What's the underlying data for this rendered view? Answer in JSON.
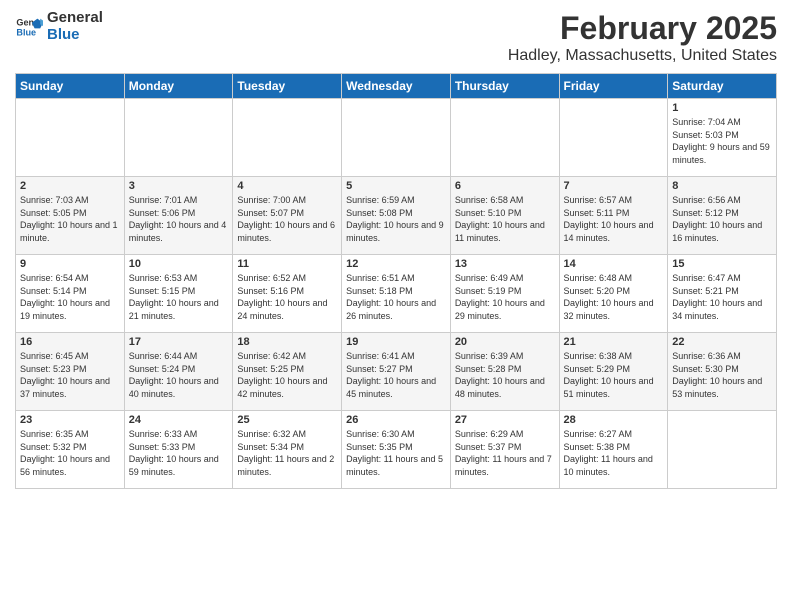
{
  "logo": {
    "line1": "General",
    "line2": "Blue"
  },
  "title": "February 2025",
  "subtitle": "Hadley, Massachusetts, United States",
  "headers": [
    "Sunday",
    "Monday",
    "Tuesday",
    "Wednesday",
    "Thursday",
    "Friday",
    "Saturday"
  ],
  "weeks": [
    [
      {
        "day": "",
        "info": ""
      },
      {
        "day": "",
        "info": ""
      },
      {
        "day": "",
        "info": ""
      },
      {
        "day": "",
        "info": ""
      },
      {
        "day": "",
        "info": ""
      },
      {
        "day": "",
        "info": ""
      },
      {
        "day": "1",
        "info": "Sunrise: 7:04 AM\nSunset: 5:03 PM\nDaylight: 9 hours and 59 minutes."
      }
    ],
    [
      {
        "day": "2",
        "info": "Sunrise: 7:03 AM\nSunset: 5:05 PM\nDaylight: 10 hours and 1 minute."
      },
      {
        "day": "3",
        "info": "Sunrise: 7:01 AM\nSunset: 5:06 PM\nDaylight: 10 hours and 4 minutes."
      },
      {
        "day": "4",
        "info": "Sunrise: 7:00 AM\nSunset: 5:07 PM\nDaylight: 10 hours and 6 minutes."
      },
      {
        "day": "5",
        "info": "Sunrise: 6:59 AM\nSunset: 5:08 PM\nDaylight: 10 hours and 9 minutes."
      },
      {
        "day": "6",
        "info": "Sunrise: 6:58 AM\nSunset: 5:10 PM\nDaylight: 10 hours and 11 minutes."
      },
      {
        "day": "7",
        "info": "Sunrise: 6:57 AM\nSunset: 5:11 PM\nDaylight: 10 hours and 14 minutes."
      },
      {
        "day": "8",
        "info": "Sunrise: 6:56 AM\nSunset: 5:12 PM\nDaylight: 10 hours and 16 minutes."
      }
    ],
    [
      {
        "day": "9",
        "info": "Sunrise: 6:54 AM\nSunset: 5:14 PM\nDaylight: 10 hours and 19 minutes."
      },
      {
        "day": "10",
        "info": "Sunrise: 6:53 AM\nSunset: 5:15 PM\nDaylight: 10 hours and 21 minutes."
      },
      {
        "day": "11",
        "info": "Sunrise: 6:52 AM\nSunset: 5:16 PM\nDaylight: 10 hours and 24 minutes."
      },
      {
        "day": "12",
        "info": "Sunrise: 6:51 AM\nSunset: 5:18 PM\nDaylight: 10 hours and 26 minutes."
      },
      {
        "day": "13",
        "info": "Sunrise: 6:49 AM\nSunset: 5:19 PM\nDaylight: 10 hours and 29 minutes."
      },
      {
        "day": "14",
        "info": "Sunrise: 6:48 AM\nSunset: 5:20 PM\nDaylight: 10 hours and 32 minutes."
      },
      {
        "day": "15",
        "info": "Sunrise: 6:47 AM\nSunset: 5:21 PM\nDaylight: 10 hours and 34 minutes."
      }
    ],
    [
      {
        "day": "16",
        "info": "Sunrise: 6:45 AM\nSunset: 5:23 PM\nDaylight: 10 hours and 37 minutes."
      },
      {
        "day": "17",
        "info": "Sunrise: 6:44 AM\nSunset: 5:24 PM\nDaylight: 10 hours and 40 minutes."
      },
      {
        "day": "18",
        "info": "Sunrise: 6:42 AM\nSunset: 5:25 PM\nDaylight: 10 hours and 42 minutes."
      },
      {
        "day": "19",
        "info": "Sunrise: 6:41 AM\nSunset: 5:27 PM\nDaylight: 10 hours and 45 minutes."
      },
      {
        "day": "20",
        "info": "Sunrise: 6:39 AM\nSunset: 5:28 PM\nDaylight: 10 hours and 48 minutes."
      },
      {
        "day": "21",
        "info": "Sunrise: 6:38 AM\nSunset: 5:29 PM\nDaylight: 10 hours and 51 minutes."
      },
      {
        "day": "22",
        "info": "Sunrise: 6:36 AM\nSunset: 5:30 PM\nDaylight: 10 hours and 53 minutes."
      }
    ],
    [
      {
        "day": "23",
        "info": "Sunrise: 6:35 AM\nSunset: 5:32 PM\nDaylight: 10 hours and 56 minutes."
      },
      {
        "day": "24",
        "info": "Sunrise: 6:33 AM\nSunset: 5:33 PM\nDaylight: 10 hours and 59 minutes."
      },
      {
        "day": "25",
        "info": "Sunrise: 6:32 AM\nSunset: 5:34 PM\nDaylight: 11 hours and 2 minutes."
      },
      {
        "day": "26",
        "info": "Sunrise: 6:30 AM\nSunset: 5:35 PM\nDaylight: 11 hours and 5 minutes."
      },
      {
        "day": "27",
        "info": "Sunrise: 6:29 AM\nSunset: 5:37 PM\nDaylight: 11 hours and 7 minutes."
      },
      {
        "day": "28",
        "info": "Sunrise: 6:27 AM\nSunset: 5:38 PM\nDaylight: 11 hours and 10 minutes."
      },
      {
        "day": "",
        "info": ""
      }
    ]
  ]
}
